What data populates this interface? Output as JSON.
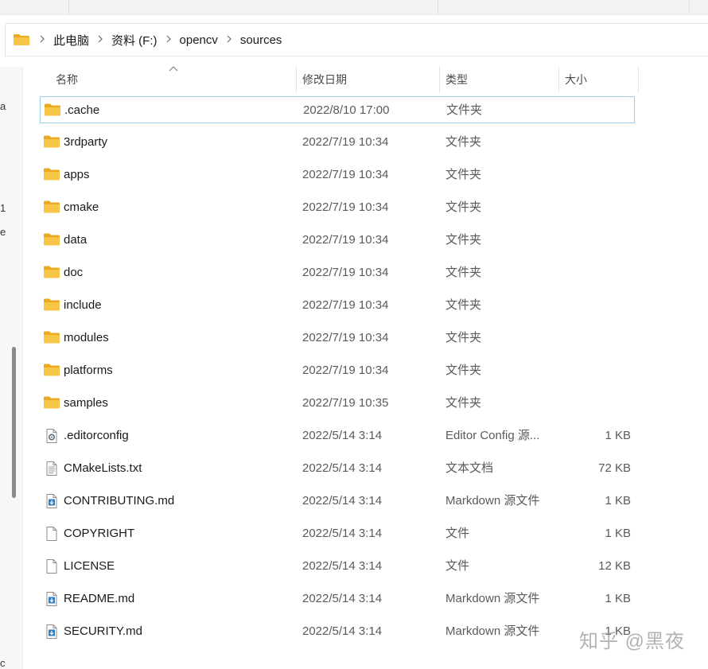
{
  "breadcrumb": [
    "此电脑",
    "资料 (F:)",
    "opencv",
    "sources"
  ],
  "left_pane_chars": [
    "a",
    "1",
    "e",
    "c"
  ],
  "columns": {
    "name": "名称",
    "date": "修改日期",
    "type": "类型",
    "size": "大小"
  },
  "files": [
    {
      "name": ".cache",
      "date": "2022/8/10 17:00",
      "type": "文件夹",
      "size": "",
      "icon": "folder-icon",
      "selected": true
    },
    {
      "name": "3rdparty",
      "date": "2022/7/19 10:34",
      "type": "文件夹",
      "size": "",
      "icon": "folder-icon"
    },
    {
      "name": "apps",
      "date": "2022/7/19 10:34",
      "type": "文件夹",
      "size": "",
      "icon": "folder-icon"
    },
    {
      "name": "cmake",
      "date": "2022/7/19 10:34",
      "type": "文件夹",
      "size": "",
      "icon": "folder-icon"
    },
    {
      "name": "data",
      "date": "2022/7/19 10:34",
      "type": "文件夹",
      "size": "",
      "icon": "folder-icon"
    },
    {
      "name": "doc",
      "date": "2022/7/19 10:34",
      "type": "文件夹",
      "size": "",
      "icon": "folder-icon"
    },
    {
      "name": "include",
      "date": "2022/7/19 10:34",
      "type": "文件夹",
      "size": "",
      "icon": "folder-icon"
    },
    {
      "name": "modules",
      "date": "2022/7/19 10:34",
      "type": "文件夹",
      "size": "",
      "icon": "folder-icon"
    },
    {
      "name": "platforms",
      "date": "2022/7/19 10:34",
      "type": "文件夹",
      "size": "",
      "icon": "folder-icon"
    },
    {
      "name": "samples",
      "date": "2022/7/19 10:35",
      "type": "文件夹",
      "size": "",
      "icon": "folder-icon"
    },
    {
      "name": ".editorconfig",
      "date": "2022/5/14 3:14",
      "type": "Editor Config 源...",
      "size": "1 KB",
      "icon": "config-file-icon"
    },
    {
      "name": "CMakeLists.txt",
      "date": "2022/5/14 3:14",
      "type": "文本文档",
      "size": "72 KB",
      "icon": "text-file-icon"
    },
    {
      "name": "CONTRIBUTING.md",
      "date": "2022/5/14 3:14",
      "type": "Markdown 源文件",
      "size": "1 KB",
      "icon": "markdown-file-icon"
    },
    {
      "name": "COPYRIGHT",
      "date": "2022/5/14 3:14",
      "type": "文件",
      "size": "1 KB",
      "icon": "blank-file-icon"
    },
    {
      "name": "LICENSE",
      "date": "2022/5/14 3:14",
      "type": "文件",
      "size": "12 KB",
      "icon": "blank-file-icon"
    },
    {
      "name": "README.md",
      "date": "2022/5/14 3:14",
      "type": "Markdown 源文件",
      "size": "1 KB",
      "icon": "markdown-file-icon"
    },
    {
      "name": "SECURITY.md",
      "date": "2022/5/14 3:14",
      "type": "Markdown 源文件",
      "size": "1 KB",
      "icon": "markdown-file-icon"
    }
  ],
  "watermark": "知乎 @黑夜",
  "colors": {
    "folder": "#f8c646",
    "folder_dark": "#e9a921",
    "selection_border": "#99cde8",
    "markdown_arrow": "#2f7fc4"
  }
}
